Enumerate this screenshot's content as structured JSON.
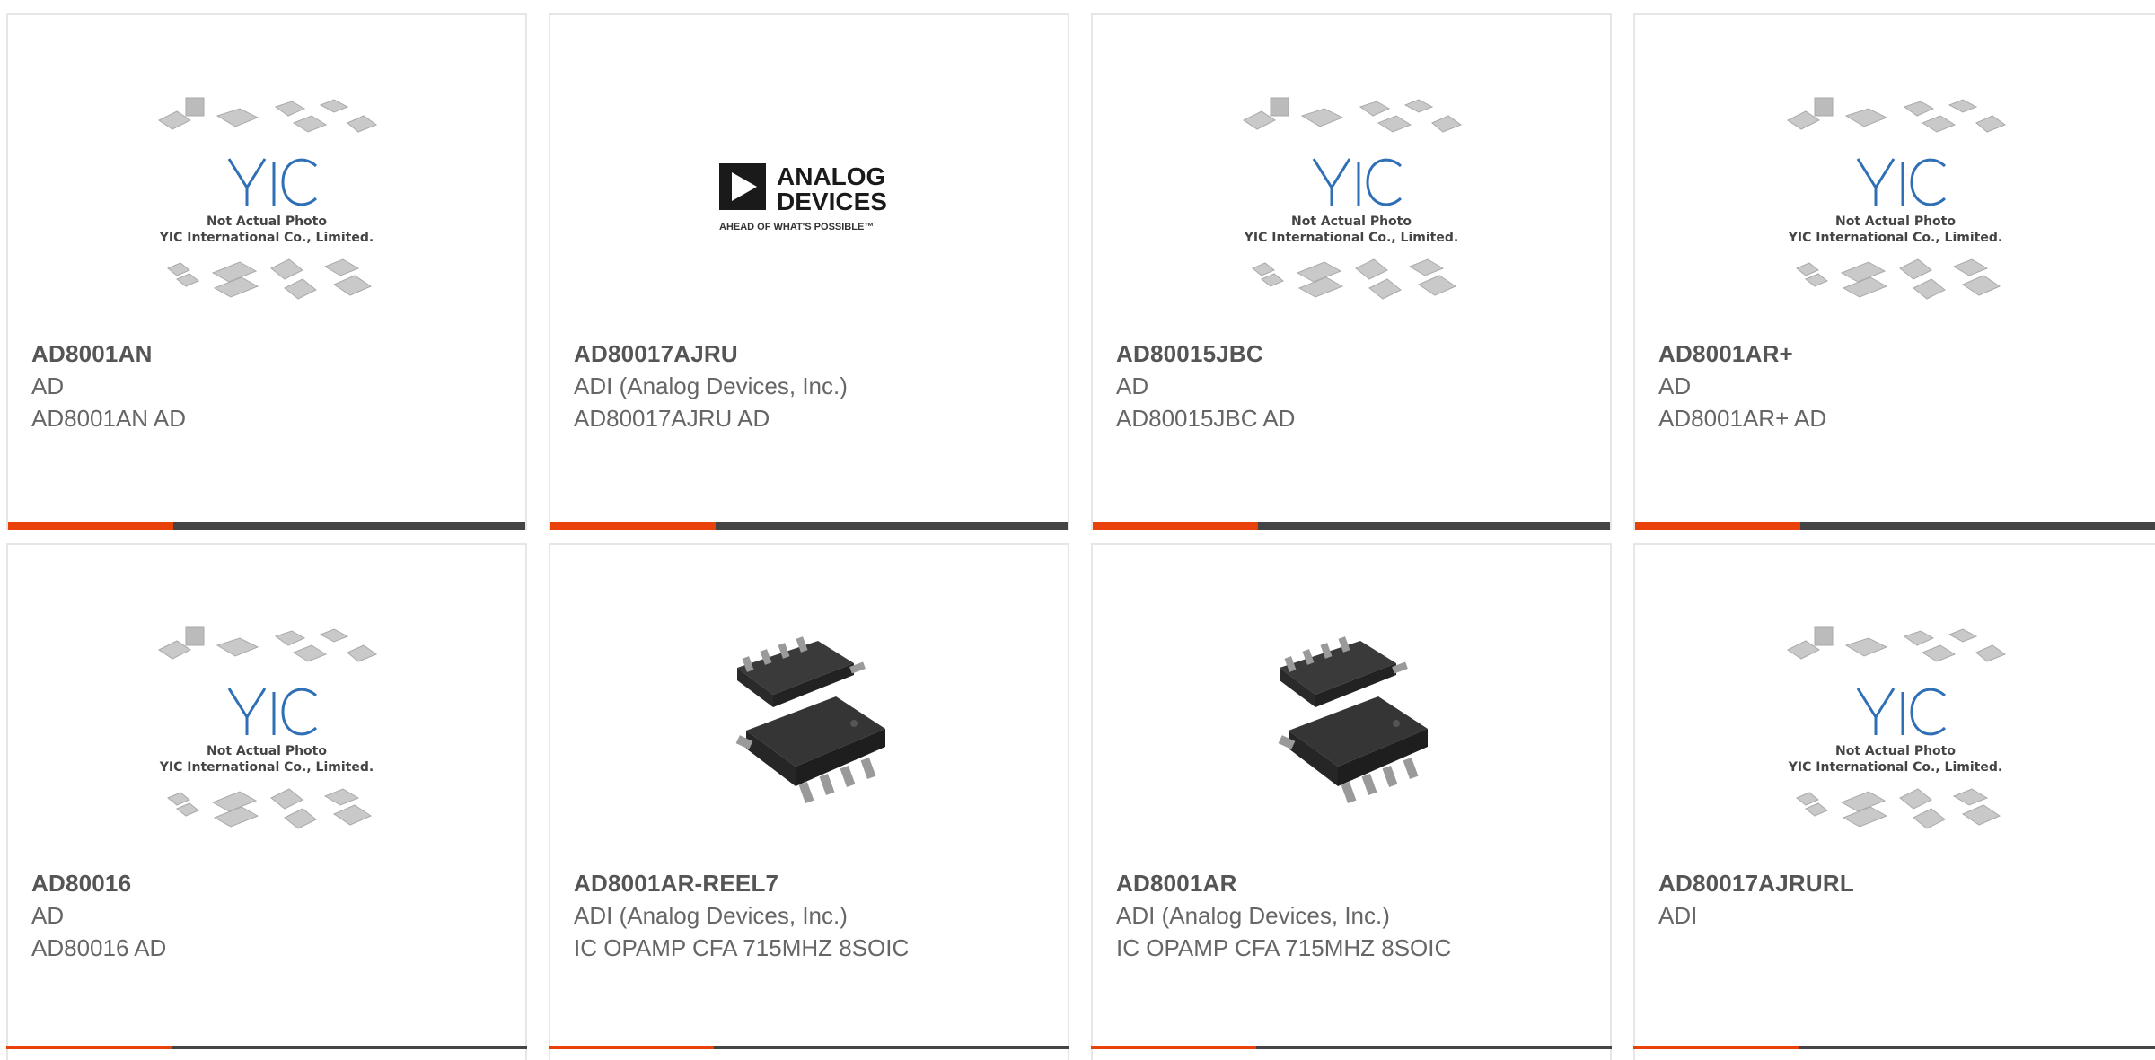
{
  "placeholder": {
    "caption_line1": "Not Actual Photo",
    "caption_line2": "YIC International Co., Limited.",
    "logo_text": "YIC"
  },
  "adi_logo": {
    "line1": "ANALOG",
    "line2": "DEVICES",
    "tagline": "AHEAD OF WHAT'S POSSIBLE™"
  },
  "products": [
    {
      "part": "AD8001AN",
      "mfr": "AD",
      "desc": "AD8001AN AD",
      "image": "placeholder"
    },
    {
      "part": "AD80017AJRU",
      "mfr": "ADI (Analog Devices, Inc.)",
      "desc": "AD80017AJRU AD",
      "image": "adi-logo"
    },
    {
      "part": "AD80015JBC",
      "mfr": "AD",
      "desc": "AD80015JBC AD",
      "image": "placeholder"
    },
    {
      "part": "AD8001AR+",
      "mfr": "AD",
      "desc": "AD8001AR+ AD",
      "image": "placeholder"
    },
    {
      "part": "AD80016",
      "mfr": "AD",
      "desc": "AD80016 AD",
      "image": "placeholder"
    },
    {
      "part": "AD8001AR-REEL7",
      "mfr": "ADI (Analog Devices, Inc.)",
      "desc": "IC OPAMP CFA 715MHZ 8SOIC",
      "image": "soic-chip"
    },
    {
      "part": "AD8001AR",
      "mfr": "ADI (Analog Devices, Inc.)",
      "desc": "IC OPAMP CFA 715MHZ 8SOIC",
      "image": "soic-chip"
    },
    {
      "part": "AD80017AJRURL",
      "mfr": "ADI",
      "desc": "",
      "image": "placeholder"
    }
  ],
  "colors": {
    "accent": "#e8410a",
    "bar": "#444444",
    "yic_blue": "#2f6fb5"
  }
}
